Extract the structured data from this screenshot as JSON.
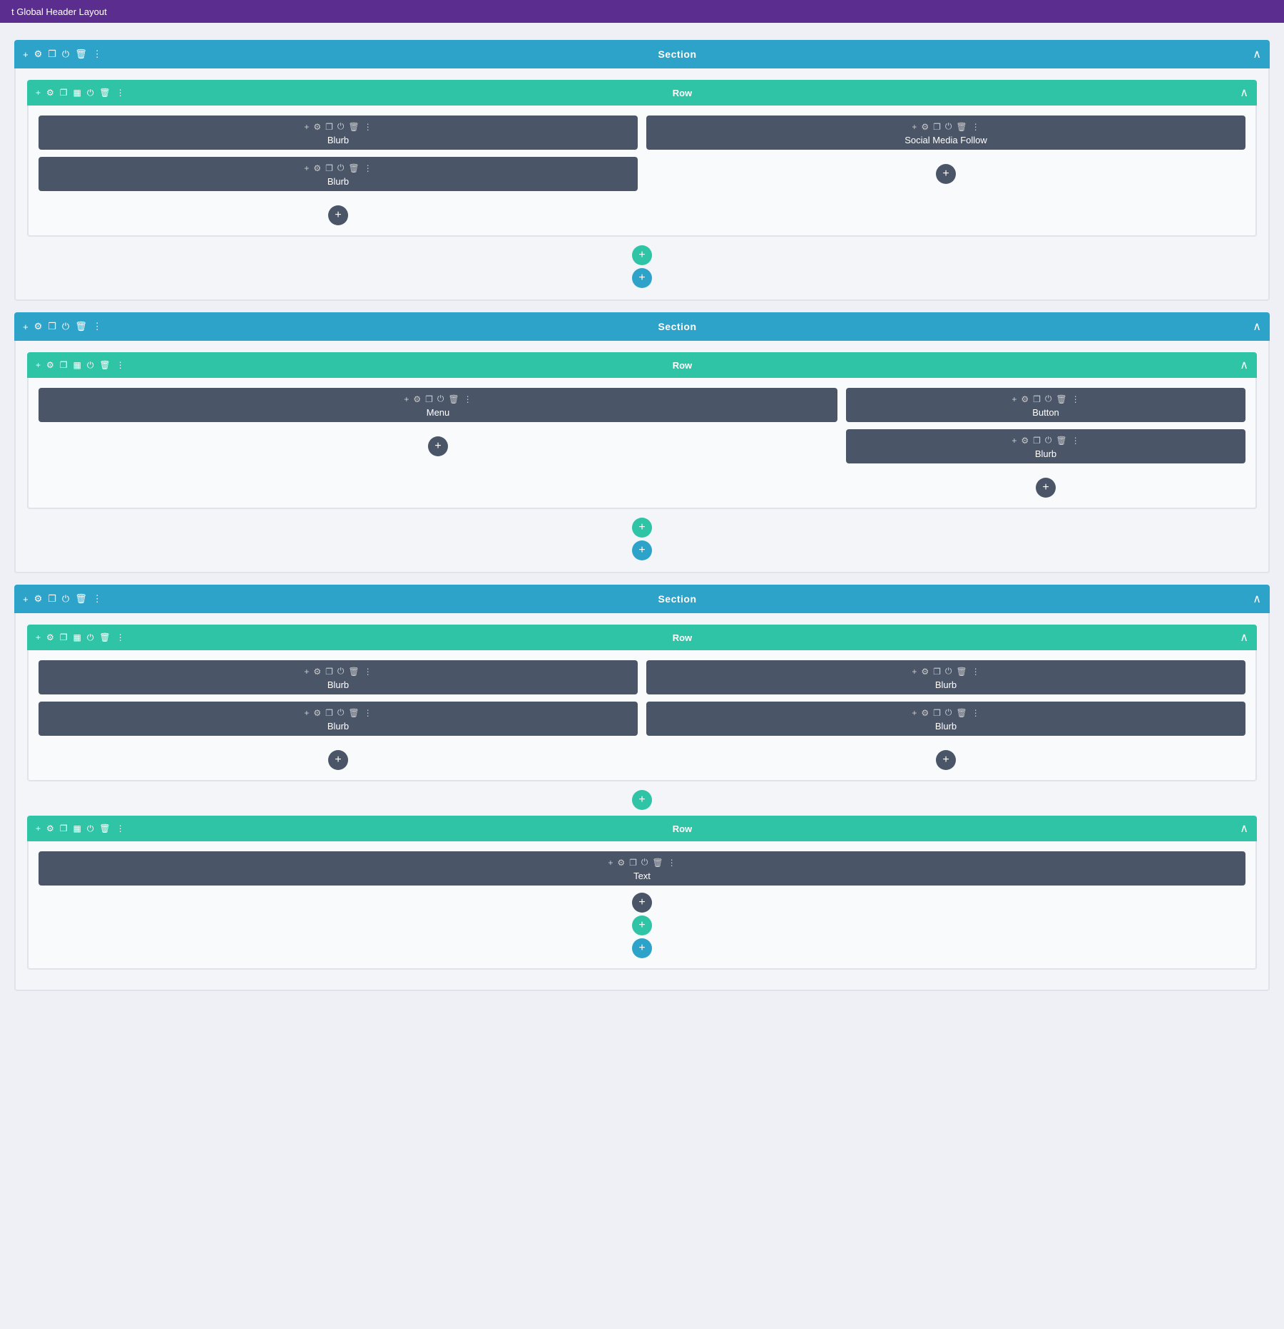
{
  "topBar": {
    "title": "t Global Header Layout"
  },
  "sections": [
    {
      "id": "section-1",
      "label": "Section",
      "rows": [
        {
          "id": "row-1-1",
          "label": "Row",
          "columns": [
            {
              "id": "col-1-1-1",
              "modules": [
                {
                  "id": "mod-1",
                  "label": "Blurb"
                },
                {
                  "id": "mod-2",
                  "label": "Blurb"
                }
              ]
            },
            {
              "id": "col-1-1-2",
              "modules": [
                {
                  "id": "mod-3",
                  "label": "Social Media Follow"
                }
              ]
            }
          ]
        }
      ]
    },
    {
      "id": "section-2",
      "label": "Section",
      "rows": [
        {
          "id": "row-2-1",
          "label": "Row",
          "layout": "left-wide",
          "columns": [
            {
              "id": "col-2-1-1",
              "modules": [
                {
                  "id": "mod-4",
                  "label": "Menu"
                }
              ]
            },
            {
              "id": "col-2-1-2",
              "modules": [
                {
                  "id": "mod-5",
                  "label": "Button"
                },
                {
                  "id": "mod-6",
                  "label": "Blurb"
                }
              ]
            }
          ]
        }
      ]
    },
    {
      "id": "section-3",
      "label": "Section",
      "rows": [
        {
          "id": "row-3-1",
          "label": "Row",
          "columns": [
            {
              "id": "col-3-1-1",
              "modules": [
                {
                  "id": "mod-7",
                  "label": "Blurb"
                },
                {
                  "id": "mod-8",
                  "label": "Blurb"
                }
              ]
            },
            {
              "id": "col-3-1-2",
              "modules": [
                {
                  "id": "mod-9",
                  "label": "Blurb"
                },
                {
                  "id": "mod-10",
                  "label": "Blurb"
                }
              ]
            }
          ]
        },
        {
          "id": "row-3-2",
          "label": "Row",
          "columns": [
            {
              "id": "col-3-2-1",
              "modules": [
                {
                  "id": "mod-11",
                  "label": "Text"
                }
              ]
            }
          ]
        }
      ]
    }
  ],
  "icons": {
    "plus": "+",
    "gear": "⚙",
    "duplicate": "❐",
    "grid": "▦",
    "power": "⏻",
    "trash": "🗑",
    "dots": "⋮",
    "chevronUp": "∧"
  },
  "colors": {
    "topBar": "#5b2d8e",
    "sectionBar": "#2ea3c9",
    "rowBar": "#2ec4a5",
    "moduleBlock": "#4a5568",
    "addBtnDark": "#4a5568",
    "addBtnTeal": "#2ec4a5",
    "addBtnBlue": "#2ea3c9"
  }
}
